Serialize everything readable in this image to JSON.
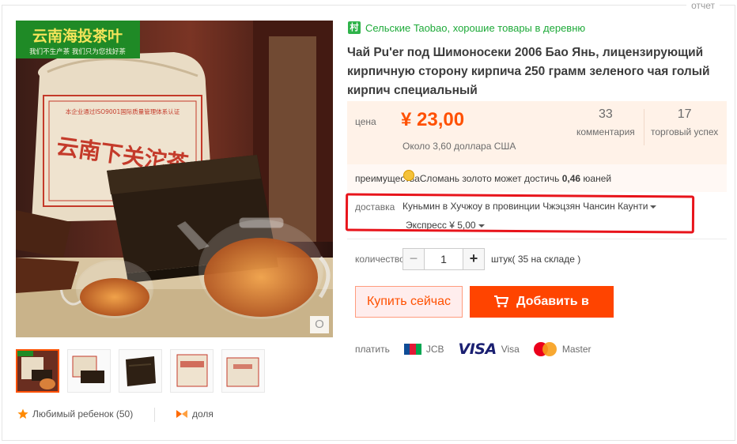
{
  "report_label": "отчет",
  "gallery": {
    "banner_title": "云南海投茶叶",
    "banner_subtitle": "我们不生产茶 我们只为您找好茶",
    "package_text": "云南下关沱茶",
    "package_top_text": "本企业通过ISO9001国际质量管理体系认证",
    "zoom_glyph": "O",
    "thumbnails": 5,
    "active_thumbnail": 1
  },
  "favorites": {
    "label": "Любимый ребенок (50)",
    "icon": "star-icon"
  },
  "share": {
    "label": "доля",
    "icon": "share-icon"
  },
  "shop": {
    "badge": "村",
    "label": "Сельские Taobao, хорошие товары в деревню"
  },
  "product": {
    "title": "Чай Pu'er под Шимоносеки 2006 Бао Янь, лицензирующий кирпичную сторону кирпича 250 грамм зеленого чая голый кирпич специальный"
  },
  "price": {
    "label": "цена",
    "value": "¥ 23,00",
    "approx": "Около 3,60 доллара США",
    "comments_count": "33",
    "comments_label": "комментария",
    "sales_count": "17",
    "sales_label": "торговый успех"
  },
  "perk": {
    "prefix": "преимущества",
    "text": "Сломань золото может достичь ",
    "amount": "0,46",
    "suffix": " юаней"
  },
  "shipping": {
    "label": "доставка",
    "route": "Куньмин в  Хучжоу в провинции Чжэцзян Чансин Каунти",
    "express": "Экспресс ¥ 5,00"
  },
  "quantity": {
    "label": "количество",
    "value": "1",
    "minus": "−",
    "plus": "+",
    "stock": "штук( 35 на складе )"
  },
  "actions": {
    "buy_now": "Купить сейчас",
    "add_to_cart": "Добавить в"
  },
  "payment": {
    "label": "платить",
    "methods": [
      "JCB",
      "Visa",
      "Master"
    ],
    "visa_logo": "VISA"
  },
  "colors": {
    "accent": "#ff5000",
    "cart_button": "#ff4400",
    "shop_green": "#1eaa39",
    "highlight_box": "#e8141b"
  }
}
